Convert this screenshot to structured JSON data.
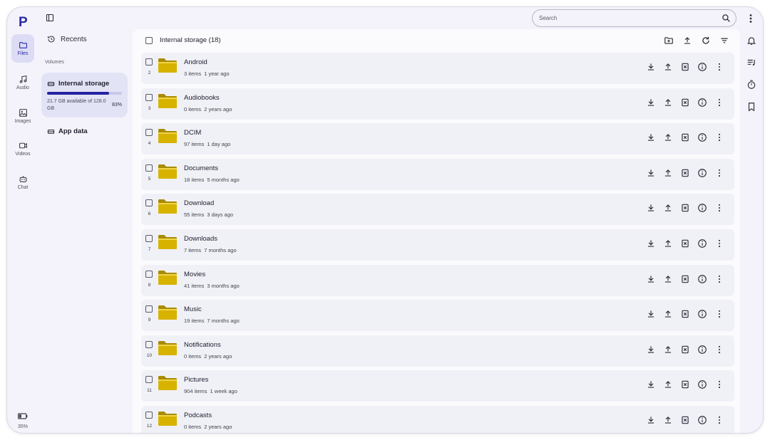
{
  "app": {
    "logo_letter": "P",
    "brand_color": "#2b2aa4"
  },
  "rail": {
    "items": [
      {
        "label": "Files",
        "icon": "folder-icon",
        "active": true
      },
      {
        "label": "Audio",
        "icon": "music-note-icon",
        "active": false
      },
      {
        "label": "Images",
        "icon": "image-icon",
        "active": false
      },
      {
        "label": "Videos",
        "icon": "video-camera-icon",
        "active": false
      },
      {
        "label": "Chat",
        "icon": "robot-icon",
        "active": false
      }
    ],
    "battery_label": "35%",
    "battery_level": 0.35
  },
  "nav": {
    "recents_label": "Recents",
    "volumes_heading": "Volumes",
    "volume": {
      "name": "Internal storage",
      "available_text": "21.7 GB available of 128.0 GB",
      "used_percent_label": "83%",
      "used_fraction": 0.83
    },
    "appdata_label": "App data"
  },
  "search": {
    "placeholder": "Search"
  },
  "main": {
    "header_title": "Internal storage (18)",
    "header_actions": [
      "new-folder-icon",
      "upload-icon",
      "refresh-icon",
      "sort-icon"
    ],
    "rows": [
      {
        "num": "2",
        "name": "Android",
        "items": "3 items",
        "age": "1 year ago"
      },
      {
        "num": "3",
        "name": "Audiobooks",
        "items": "0 items",
        "age": "2 years ago"
      },
      {
        "num": "4",
        "name": "DCIM",
        "items": "97 items",
        "age": "1 day ago"
      },
      {
        "num": "5",
        "name": "Documents",
        "items": "18 items",
        "age": "5 months ago"
      },
      {
        "num": "6",
        "name": "Download",
        "items": "55 items",
        "age": "3 days ago"
      },
      {
        "num": "7",
        "name": "Downloads",
        "items": "7 items",
        "age": "7 months ago"
      },
      {
        "num": "8",
        "name": "Movies",
        "items": "41 items",
        "age": "3 months ago"
      },
      {
        "num": "9",
        "name": "Music",
        "items": "19 items",
        "age": "7 months ago"
      },
      {
        "num": "10",
        "name": "Notifications",
        "items": "0 items",
        "age": "2 years ago"
      },
      {
        "num": "11",
        "name": "Pictures",
        "items": "904 items",
        "age": "1 week ago"
      },
      {
        "num": "12",
        "name": "Podcasts",
        "items": "0 items",
        "age": "2 years ago"
      }
    ],
    "row_actions": [
      "download-icon",
      "upload-icon",
      "delete-icon",
      "info-icon",
      "more-vert-icon"
    ]
  },
  "right_rail": [
    "bell-icon",
    "playlist-icon",
    "timer-icon",
    "bookmark-icon"
  ],
  "colors": {
    "folder": "#d7b300",
    "accent": "#2323a0",
    "background": "#f4f3fb"
  }
}
